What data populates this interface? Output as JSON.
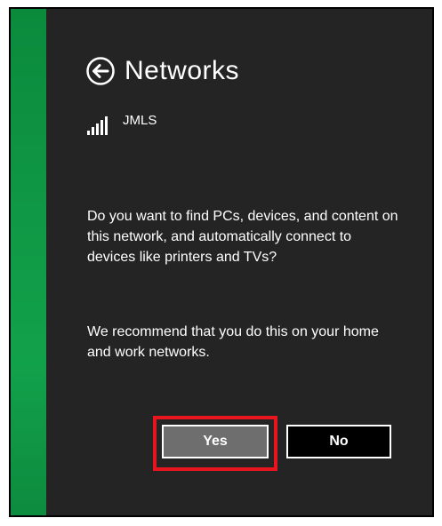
{
  "header": {
    "title": "Networks",
    "back_icon": "back-arrow-circle-icon"
  },
  "network": {
    "name": "JMLS",
    "signal_icon": "signal-strength-icon",
    "signal_bars": 5
  },
  "prompt": {
    "question": "Do you want to find PCs, devices, and content on this network, and automatically connect to devices like printers and TVs?",
    "recommendation": "We recommend that you do this on your home and work networks."
  },
  "buttons": {
    "yes_label": "Yes",
    "no_label": "No"
  },
  "colors": {
    "accent_green": "#0f9845",
    "panel_bg": "#242424",
    "highlight_red": "#e8141e",
    "yes_bg": "#6e6e6e",
    "no_bg": "#000000"
  }
}
